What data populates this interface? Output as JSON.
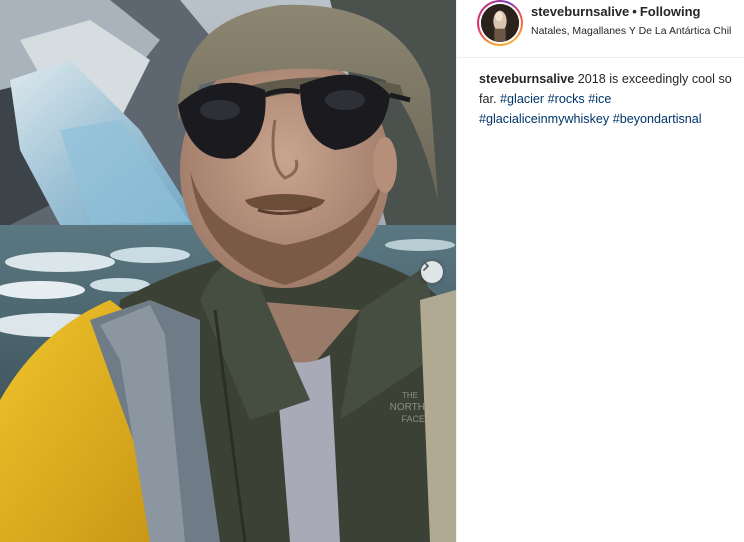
{
  "post": {
    "username": "steveburnsalive",
    "separator": "•",
    "follow_status": "Following",
    "location": "Natales, Magallanes Y De La Antártica Chil",
    "caption": {
      "author": "steveburnsalive",
      "text": "2018 is exceedingly cool so far.",
      "hashtags": [
        "#glacier",
        "#rocks",
        "#ice",
        "#glacialiceinmywhiskey",
        "#beyondartisnal"
      ]
    },
    "photo": {
      "jacket_logo": [
        "THE",
        "NORTH",
        "FACE"
      ]
    }
  },
  "colors": {
    "hashtag": "#003569",
    "text": "#262626",
    "jacket": "#e2b21c",
    "fleece": "#3b4235"
  },
  "icons": {
    "next": "chevron-right-icon"
  }
}
